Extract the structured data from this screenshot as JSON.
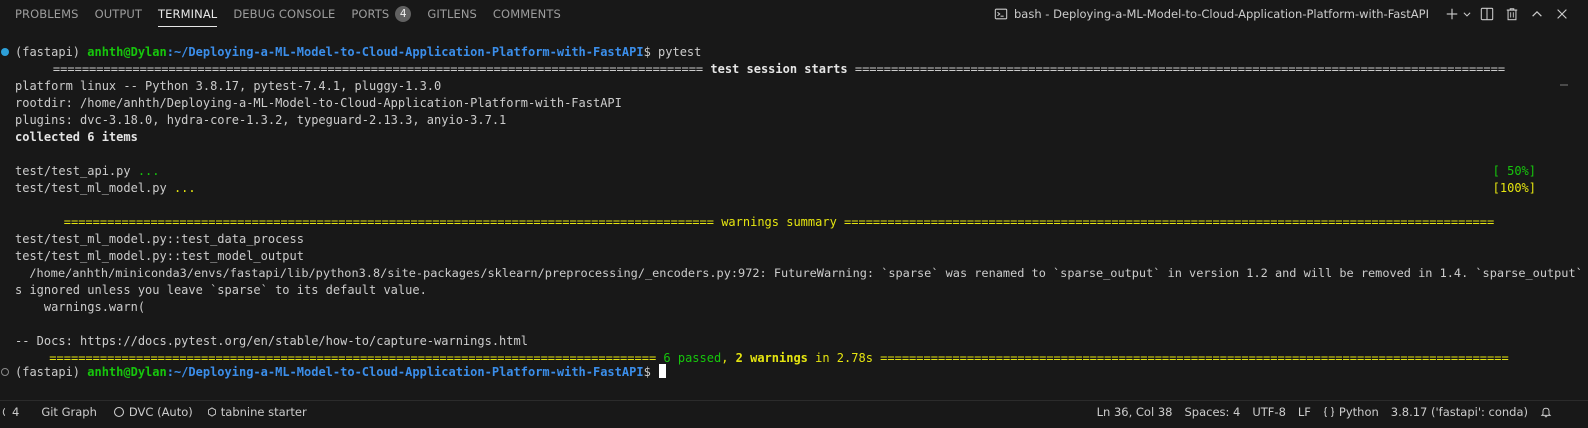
{
  "tabs": [
    {
      "label": "PROBLEMS"
    },
    {
      "label": "OUTPUT"
    },
    {
      "label": "TERMINAL",
      "active": true
    },
    {
      "label": "DEBUG CONSOLE"
    },
    {
      "label": "PORTS",
      "badge": "4"
    },
    {
      "label": "GITLENS"
    },
    {
      "label": "COMMENTS"
    }
  ],
  "terminal_title": "bash - Deploying-a-ML-Model-to-Cloud-Application-Platform-with-FastAPI",
  "header_icons": [
    "plus-icon",
    "chevron-down-icon",
    "split-icon",
    "trash-icon",
    "chevron-up-icon",
    "close-icon"
  ],
  "terminal": {
    "prompt1": {
      "env": "(fastapi) ",
      "user": "anhth@Dylan",
      "path": ":~/Deploying-a-ML-Model-to-Cloud-Application-Platform-with-FastAPI",
      "sym": "$ ",
      "cmd": "pytest"
    },
    "session_header": " test session starts ",
    "platform": "platform linux -- Python 3.8.17, pytest-7.4.1, pluggy-1.3.0",
    "rootdir": "rootdir: /home/anhth/Deploying-a-ML-Model-to-Cloud-Application-Platform-with-FastAPI",
    "plugins": "plugins: dvc-3.18.0, hydra-core-1.3.2, typeguard-2.13.3, anyio-3.7.1",
    "collected": "collected 6 items",
    "test1": {
      "file": "test/test_api.py ",
      "dots": "...",
      "pct": "[ 50%]"
    },
    "test2": {
      "file": "test/test_ml_model.py ",
      "dots": "...",
      "pct": "[100%]"
    },
    "warnings_header": " warnings summary ",
    "warn1": "test/test_ml_model.py::test_data_process",
    "warn2": "test/test_ml_model.py::test_model_output",
    "warn3": "  /home/anhth/miniconda3/envs/fastapi/lib/python3.8/site-packages/sklearn/preprocessing/_encoders.py:972: FutureWarning: `sparse` was renamed to `sparse_output` in version 1.2 and will be removed in 1.4. `sparse_output` i",
    "warn4": "s ignored unless you leave `sparse` to its default value.",
    "warn5": "    warnings.warn(",
    "docs": "-- Docs: https://docs.pytest.org/en/stable/how-to/capture-warnings.html",
    "summary": {
      "passed": "6 passed",
      "comma": ", ",
      "warnings": "2 warnings",
      "time": " in 2.78s "
    },
    "prompt2": {
      "env": "(fastapi) ",
      "user": "anhth@Dylan",
      "path": ":~/Deploying-a-ML-Model-to-Cloud-Application-Platform-with-FastAPI",
      "sym": "$ "
    }
  },
  "statusbar": {
    "ports": "4",
    "git_graph": "Git Graph",
    "dvc": "DVC (Auto)",
    "tabnine": "tabnine starter",
    "position": "Ln 36, Col 38",
    "spaces": "Spaces: 4",
    "encoding": "UTF-8",
    "eol": "LF",
    "language": "Python",
    "interpreter": "3.8.17 ('fastapi': conda)"
  }
}
